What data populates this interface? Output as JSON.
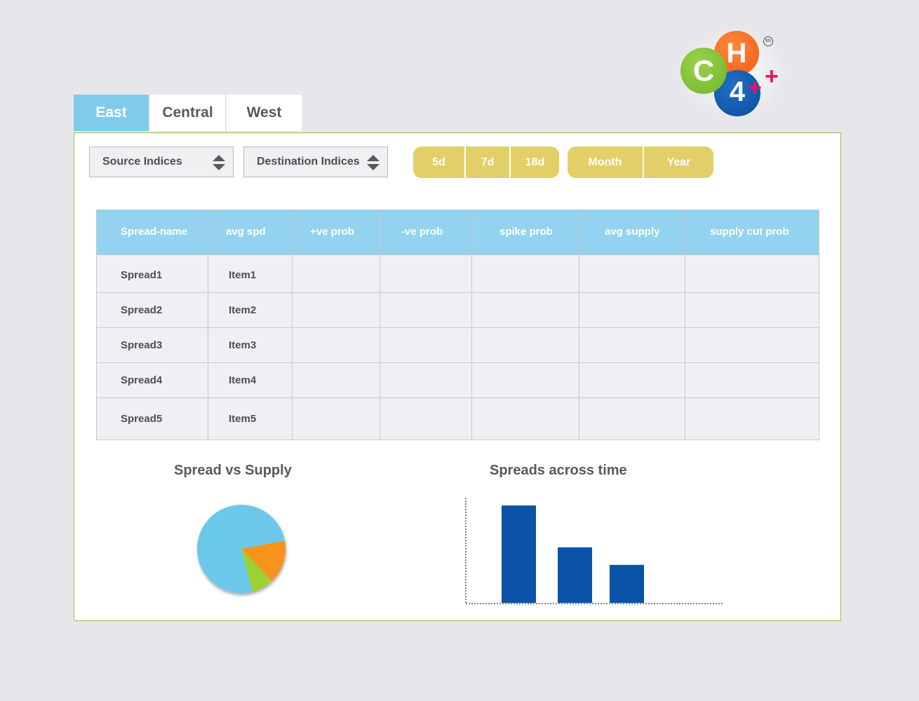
{
  "logo": {
    "letters": [
      "C",
      "H",
      "4",
      "+",
      "+"
    ],
    "trademark": "tm",
    "colors": {
      "c": "#78bc34",
      "h": "#f26a1f",
      "four": "#0d55a8",
      "plus": "#e8175d"
    }
  },
  "tabs": [
    {
      "label": "East",
      "active": true
    },
    {
      "label": "Central",
      "active": false
    },
    {
      "label": "West",
      "active": false
    }
  ],
  "selects": {
    "source": {
      "value": "Source Indices",
      "icon": "up-down-arrows-icon"
    },
    "destination": {
      "value": "Destination Indices",
      "icon": "up-down-arrows-icon"
    }
  },
  "periods": {
    "days": [
      "5d",
      "7d",
      "18d"
    ],
    "ranges": [
      "Month",
      "Year"
    ],
    "button_color": "#e3cf67"
  },
  "table": {
    "headers": [
      "Spread-name",
      "avg spd",
      "+ve prob",
      "-ve prob",
      "spike prob",
      "avg supply",
      "supply cut prob"
    ],
    "rows": [
      [
        "Spread1",
        "Item1",
        "",
        "",
        "",
        "",
        ""
      ],
      [
        "Spread2",
        "Item2",
        "",
        "",
        "",
        "",
        ""
      ],
      [
        "Spread3",
        "Item3",
        "",
        "",
        "",
        "",
        ""
      ],
      [
        "Spread4",
        "Item4",
        "",
        "",
        "",
        "",
        ""
      ],
      [
        "Spread5",
        "Item5",
        "",
        "",
        "",
        "",
        ""
      ]
    ],
    "header_color": "#93d3ef"
  },
  "charts": {
    "pie_title": "Spread vs Supply",
    "bar_title": "Spreads across time"
  },
  "chart_data": [
    {
      "type": "pie",
      "title": "Spread vs Supply",
      "values": [
        76,
        16,
        8
      ],
      "colors": [
        "#6cc8ea",
        "#f7931e",
        "#9ad232"
      ]
    },
    {
      "type": "bar",
      "title": "Spreads across time",
      "categories": [
        "",
        "",
        ""
      ],
      "values": [
        100,
        57,
        39
      ],
      "ylim": [
        0,
        108
      ],
      "color": "#0b53a6"
    }
  ]
}
